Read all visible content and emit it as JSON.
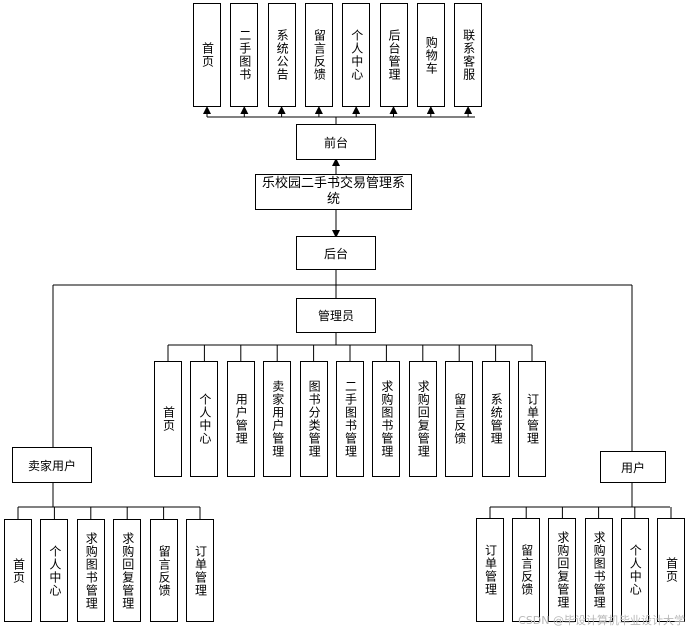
{
  "system_title": "乐校园二手书交易管理系统",
  "frontend": {
    "label": "前台",
    "modules": [
      "首页",
      "二手图书",
      "系统公告",
      "留言反馈",
      "个人中心",
      "后台管理",
      "购物车",
      "联系客服"
    ]
  },
  "backend": {
    "label": "后台"
  },
  "admin": {
    "label": "管理员",
    "modules": [
      "首页",
      "个人中心",
      "用户管理",
      "卖家用户管理",
      "图书分类管理",
      "二手图书管理",
      "求购图书管理",
      "求购回复管理",
      "留言反馈",
      "系统管理",
      "订单管理"
    ]
  },
  "seller": {
    "label": "卖家用户",
    "modules": [
      "首页",
      "个人中心",
      "求购图书管理",
      "求购回复管理",
      "留言反馈",
      "订单管理"
    ]
  },
  "user": {
    "label": "用户",
    "modules": [
      "订单管理",
      "留言反馈",
      "求购回复管理",
      "求购图书管理",
      "个人中心",
      "首页"
    ]
  },
  "watermark": "CSDN @毕设计算机毕业设计大学"
}
